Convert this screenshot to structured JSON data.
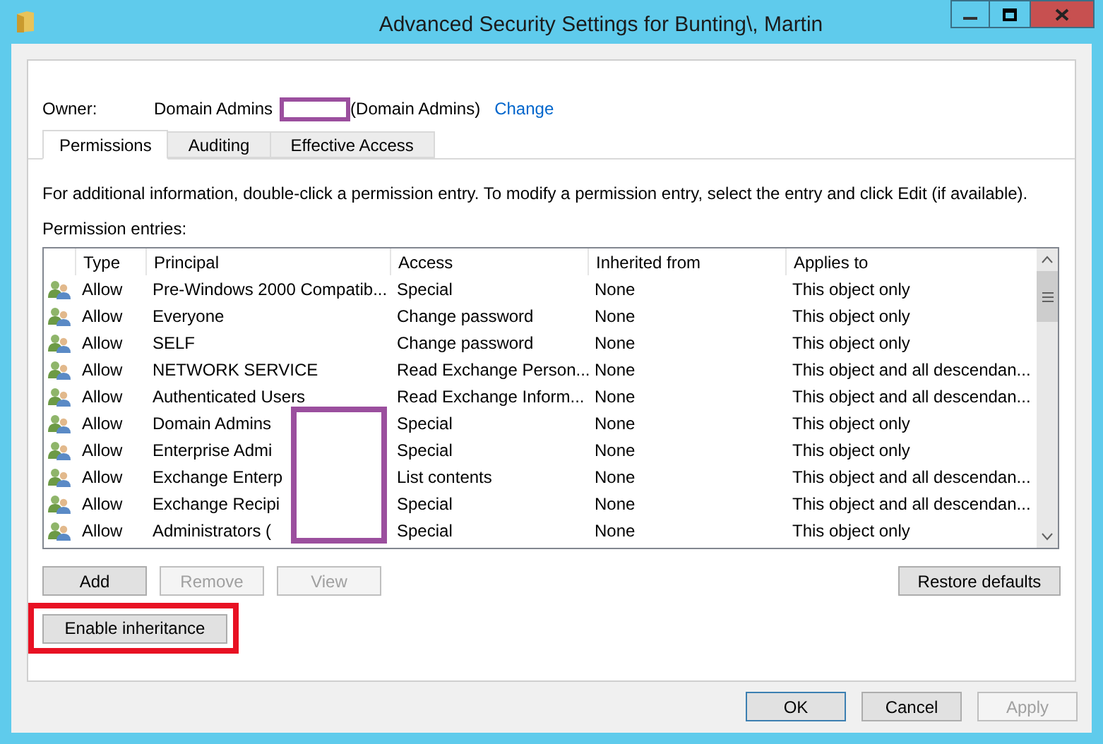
{
  "window": {
    "title": "Advanced Security Settings for Bunting\\, Martin"
  },
  "owner": {
    "label": "Owner:",
    "name": "Domain Admins",
    "suffix": "(Domain Admins)",
    "link": "Change"
  },
  "tabs": [
    {
      "label": "Permissions",
      "selected": true
    },
    {
      "label": "Auditing",
      "selected": false
    },
    {
      "label": "Effective Access",
      "selected": false
    }
  ],
  "description": "For additional information, double-click a permission entry. To modify a permission entry, select the entry and click Edit (if available).",
  "entries_label": "Permission entries:",
  "table": {
    "columns": [
      "Type",
      "Principal",
      "Access",
      "Inherited from",
      "Applies to"
    ],
    "rows": [
      {
        "type": "Allow",
        "principal": "Pre-Windows 2000 Compatib...",
        "access": "Special",
        "inherited_from": "None",
        "applies_to": "This object only"
      },
      {
        "type": "Allow",
        "principal": "Everyone",
        "access": "Change password",
        "inherited_from": "None",
        "applies_to": "This object only"
      },
      {
        "type": "Allow",
        "principal": "SELF",
        "access": "Change password",
        "inherited_from": "None",
        "applies_to": "This object only"
      },
      {
        "type": "Allow",
        "principal": "NETWORK SERVICE",
        "access": "Read Exchange Person...",
        "inherited_from": "None",
        "applies_to": "This object and all descendan..."
      },
      {
        "type": "Allow",
        "principal": "Authenticated Users",
        "access": "Read Exchange Inform...",
        "inherited_from": "None",
        "applies_to": "This object and all descendan..."
      },
      {
        "type": "Allow",
        "principal": "Domain Admins",
        "access": "Special",
        "inherited_from": "None",
        "applies_to": "This object only"
      },
      {
        "type": "Allow",
        "principal": "Enterprise Admi",
        "access": "Special",
        "inherited_from": "None",
        "applies_to": "This object only"
      },
      {
        "type": "Allow",
        "principal": "Exchange Enterp",
        "access": "List contents",
        "inherited_from": "None",
        "applies_to": "This object and all descendan..."
      },
      {
        "type": "Allow",
        "principal": "Exchange Recipi",
        "access": "Special",
        "inherited_from": "None",
        "applies_to": "This object and all descendan..."
      },
      {
        "type": "Allow",
        "principal": "Administrators (",
        "access": "Special",
        "inherited_from": "None",
        "applies_to": "This object only"
      }
    ]
  },
  "list_buttons": [
    {
      "label": "Add",
      "disabled": false
    },
    {
      "label": "Remove",
      "disabled": true
    },
    {
      "label": "View",
      "disabled": true
    }
  ],
  "restore_button": {
    "label": "Restore defaults"
  },
  "inheritance_button": {
    "label": "Enable inheritance"
  },
  "dialog_buttons": [
    {
      "label": "OK",
      "disabled": false,
      "default": true
    },
    {
      "label": "Cancel",
      "disabled": false,
      "default": false
    },
    {
      "label": "Apply",
      "disabled": true,
      "default": false
    }
  ]
}
